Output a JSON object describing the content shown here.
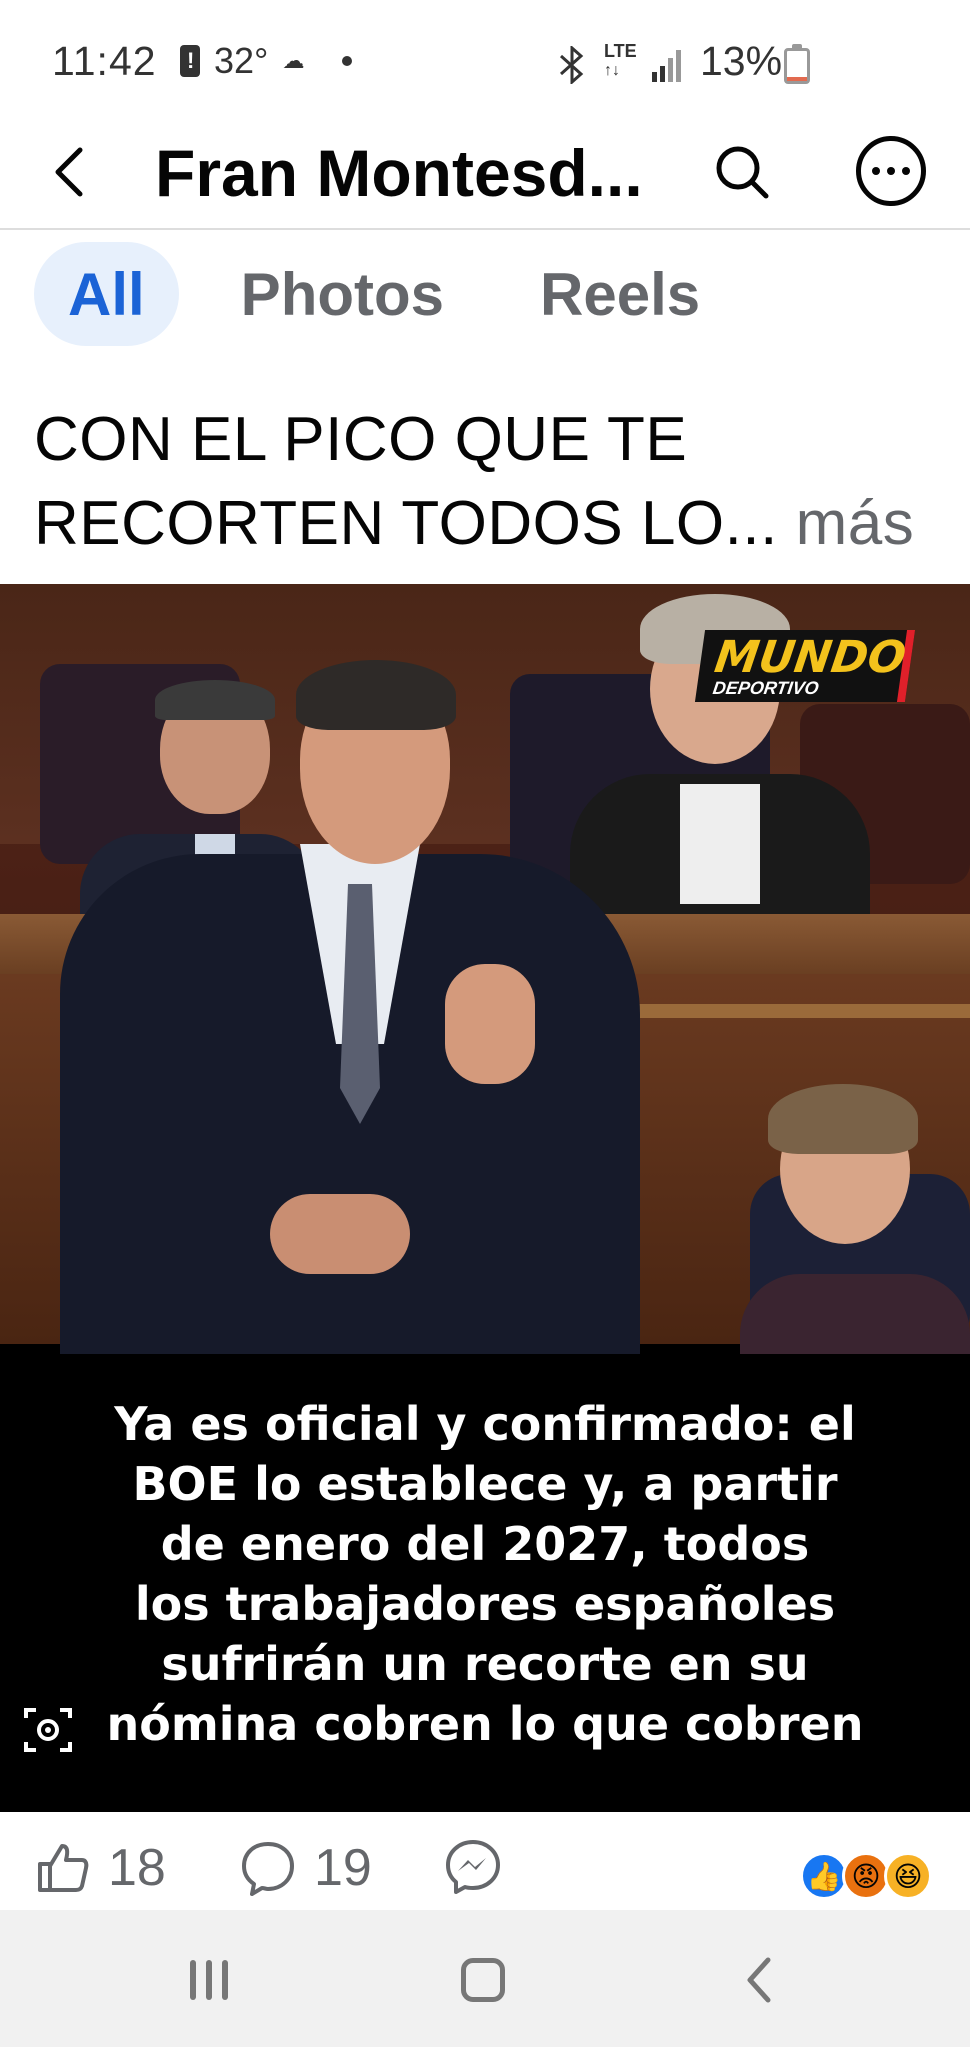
{
  "status_bar": {
    "time": "11:42",
    "temperature": "32°",
    "battery_percent": "13%",
    "network": "LTE",
    "icons": [
      "alert-icon",
      "weather-icon",
      "bluetooth-icon",
      "lte-icon",
      "signal-icon",
      "battery-icon"
    ],
    "battery_level": 0.13
  },
  "header": {
    "title": "Fran Montesd...",
    "icons": [
      "back-arrow-icon",
      "search-icon",
      "more-options-icon"
    ]
  },
  "tabs": [
    {
      "label": "All",
      "active": true
    },
    {
      "label": "Photos",
      "active": false
    },
    {
      "label": "Reels",
      "active": false
    }
  ],
  "post": {
    "text_line1": "CON EL PICO QUE TE",
    "text_line2": "RECORTEN TODOS LO...",
    "more_label": "más",
    "image": {
      "logo_top": "MUNDO",
      "logo_bottom": "DEPORTIVO",
      "caption_lines": [
        "Ya es oficial y confirmado: el",
        "BOE lo establece y, a partir",
        "de enero del 2027, todos",
        "los trabajadores españoles",
        "sufrirán un recorte en su",
        "nómina cobren lo que cobren"
      ]
    },
    "likes": "18",
    "comments": "19",
    "reactions": [
      "like-reaction-icon",
      "angry-reaction-icon",
      "haha-reaction-icon"
    ]
  },
  "colors": {
    "accent": "#1b63d6",
    "tab_active_bg": "#e7f0fc",
    "muted": "#65676b",
    "logo_yellow": "#f3c21c",
    "logo_red": "#e0202a"
  }
}
